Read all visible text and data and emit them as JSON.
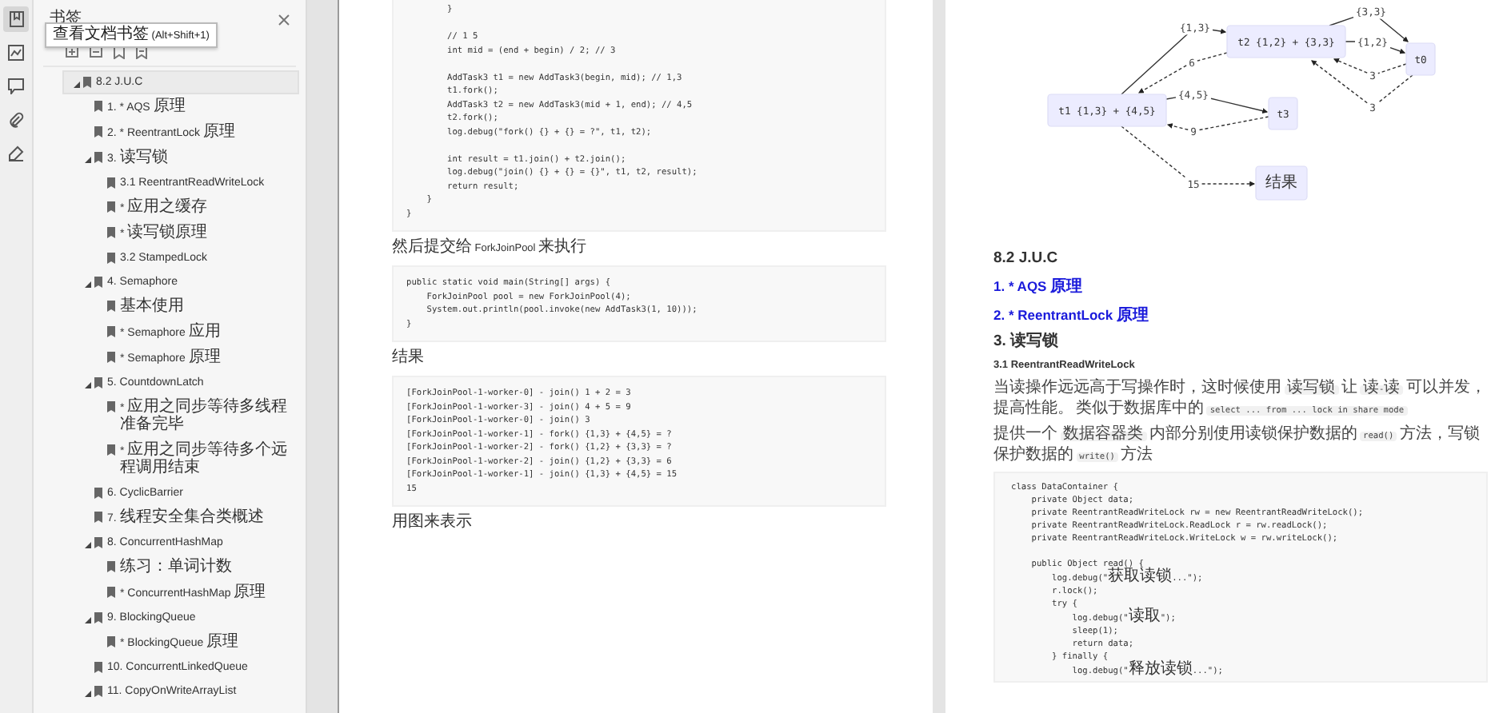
{
  "rail_tabs": [
    {
      "kind": "bookmarks",
      "selected": true
    },
    {
      "kind": "thumbnails",
      "selected": false
    },
    {
      "kind": "comments",
      "selected": false
    },
    {
      "kind": "attachments",
      "selected": false
    },
    {
      "kind": "signatures",
      "selected": false
    }
  ],
  "tooltip": "查看文档书签 (Alt+Shift+1)",
  "sidebar": {
    "title": "书签",
    "bookmarks": [
      {
        "label": "8.2 J.U.C",
        "selected": true,
        "expanded": true,
        "children": [
          {
            "label": "1. * AQS 原理",
            "selected": false
          },
          {
            "label": "2. * ReentrantLock 原理",
            "selected": false
          },
          {
            "label": "3. 读写锁",
            "selected": false,
            "expanded": true,
            "children": [
              {
                "label": "3.1 ReentrantReadWriteLock",
                "selected": false
              },
              {
                "label": "* 应用之缓存",
                "selected": false
              },
              {
                "label": "* 读写锁原理",
                "selected": false
              },
              {
                "label": "3.2 StampedLock",
                "selected": false
              }
            ]
          },
          {
            "label": "4. Semaphore",
            "selected": false,
            "expanded": true,
            "children": [
              {
                "label": "基本使用",
                "selected": false
              },
              {
                "label": "* Semaphore 应用",
                "selected": false
              },
              {
                "label": "* Semaphore 原理",
                "selected": false
              }
            ]
          },
          {
            "label": "5. CountdownLatch",
            "selected": false,
            "expanded": true,
            "children": [
              {
                "label": "* 应用之同步等待多线程准备完毕",
                "selected": false
              },
              {
                "label": "* 应用之同步等待多个远程调用结束",
                "selected": false
              }
            ]
          },
          {
            "label": "6. CyclicBarrier",
            "selected": false
          },
          {
            "label": "7. 线程安全集合类概述",
            "selected": false
          },
          {
            "label": "8. ConcurrentHashMap",
            "selected": false,
            "expanded": true,
            "children": [
              {
                "label": "练习：单词计数",
                "selected": false
              },
              {
                "label": "* ConcurrentHashMap 原理",
                "selected": false
              }
            ]
          },
          {
            "label": "9. BlockingQueue",
            "selected": false,
            "expanded": true,
            "children": [
              {
                "label": "* BlockingQueue 原理",
                "selected": false
              }
            ]
          },
          {
            "label": "10. ConcurrentLinkedQueue",
            "selected": false
          },
          {
            "label": "11. CopyOnWriteArrayList",
            "selected": false,
            "expanded": true
          }
        ]
      }
    ]
  },
  "left_page": [
    {
      "kind": "code",
      "groups": [
        [
          "        }"
        ],
        [
          "        // 1 5",
          "        int mid = (end + begin) / 2; // 3"
        ],
        [
          "        AddTask3 t1 = new AddTask3(begin, mid); // 1,3",
          "        t1.fork();",
          "        AddTask3 t2 = new AddTask3(mid + 1, end); // 4,5",
          "        t2.fork();",
          "        log.debug(\"fork() {} + {} = ?\", t1, t2);"
        ],
        [
          "        int result = t1.join() + t2.join();",
          "        log.debug(\"join() {} + {} = {}\", t1, t2, result);",
          "        return result;",
          "    }",
          "}"
        ]
      ]
    },
    {
      "kind": "text",
      "text": "然后提交给 ForkJoinPool 来执行"
    },
    {
      "kind": "code",
      "groups": [
        [
          "public static void main(String[] args) {",
          "    ForkJoinPool pool = new ForkJoinPool(4);",
          "    System.out.println(pool.invoke(new AddTask3(1, 10)));",
          "}"
        ]
      ]
    },
    {
      "kind": "text",
      "text": "结果"
    },
    {
      "kind": "code",
      "groups": [
        [
          "[ForkJoinPool-1-worker-0] - join() 1 + 2 = 3",
          "[ForkJoinPool-1-worker-3] - join() 4 + 5 = 9",
          "[ForkJoinPool-1-worker-0] - join() 3",
          "[ForkJoinPool-1-worker-1] - fork() {1,3} + {4,5} = ?",
          "[ForkJoinPool-1-worker-2] - fork() {1,2} + {3,3} = ?",
          "[ForkJoinPool-1-worker-2] - join() {1,2} + {3,3} = 6",
          "[ForkJoinPool-1-worker-1] - join() {1,3} + {4,5} = 15",
          "15"
        ]
      ]
    },
    {
      "kind": "text",
      "text": "用图来表示"
    }
  ],
  "diagram": {
    "nodes": [
      "t1 {1,3} + {4,5}",
      "t2 {1,2} + {3,3}",
      "t0",
      "t3",
      "结果"
    ],
    "edges": [
      {
        "label": "{1,3}",
        "kind": "solid"
      },
      {
        "label": "{3,3}",
        "kind": "solid"
      },
      {
        "label": "{1,2}",
        "kind": "solid"
      },
      {
        "label": "6",
        "kind": "dashed"
      },
      {
        "label": "3",
        "kind": "dashed"
      },
      {
        "label": "3",
        "kind": "dashed"
      },
      {
        "label": "{4,5}",
        "kind": "solid"
      },
      {
        "label": "9",
        "kind": "dashed"
      },
      {
        "label": "15",
        "kind": "dashed"
      }
    ]
  },
  "right_page": [
    {
      "kind": "heading",
      "text": "8.2 J.U.C"
    },
    {
      "kind": "link",
      "text": "1. * AQS 原理"
    },
    {
      "kind": "link",
      "text": "2. * ReentrantLock 原理"
    },
    {
      "kind": "heading",
      "text": "3. 读写锁"
    },
    {
      "kind": "subheading",
      "text": "3.1 ReentrantReadWriteLock"
    },
    {
      "kind": "paragraph",
      "parts": [
        {
          "kind": "text",
          "text": "当读操作远远高于写操作时，这时候使用 "
        },
        {
          "kind": "code",
          "text": "读写锁"
        },
        {
          "kind": "text",
          "text": " 让 "
        },
        {
          "kind": "code",
          "text": "读-读"
        },
        {
          "kind": "text",
          "text": " 可以并发，提高性能。 类似于数据库中的 "
        },
        {
          "kind": "code",
          "text": "select ... from ... lock in share mode"
        }
      ]
    },
    {
      "kind": "paragraph",
      "parts": [
        {
          "kind": "text",
          "text": "提供一个 "
        },
        {
          "kind": "code",
          "text": "数据容器类"
        },
        {
          "kind": "text",
          "text": " 内部分别使用读锁保护数据的 "
        },
        {
          "kind": "code",
          "text": "read()"
        },
        {
          "kind": "text",
          "text": " 方法，写锁保护数据的 "
        },
        {
          "kind": "code",
          "text": "write()"
        },
        {
          "kind": "text",
          "text": " 方法"
        }
      ]
    },
    {
      "kind": "code",
      "groups": [
        [
          "class DataContainer {",
          "    private Object data;",
          "    private ReentrantReadWriteLock rw = new ReentrantReadWriteLock();",
          "    private ReentrantReadWriteLock.ReadLock r = rw.readLock();",
          "    private ReentrantReadWriteLock.WriteLock w = rw.writeLock();"
        ],
        [
          "    public Object read() {",
          "        log.debug(\"获取读锁...\");",
          "        r.lock();",
          "        try {",
          "            log.debug(\"读取\");",
          "            sleep(1);",
          "            return data;",
          "        } finally {",
          "            log.debug(\"释放读锁...\");"
        ]
      ]
    }
  ]
}
